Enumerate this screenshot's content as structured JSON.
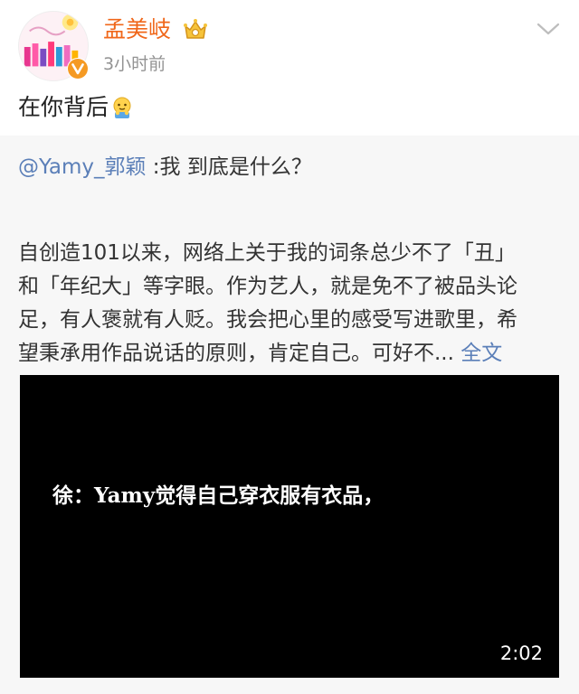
{
  "post": {
    "author_name": "孟美岐",
    "time": "3小时前",
    "text": "在你背后",
    "emoji_icon": "shy-face-emoji",
    "avatar_icon": "avatar-image",
    "badge_icon": "verified-v-icon",
    "crown_icon": "vip-crown-icon",
    "menu_icon": "chevron-down-icon"
  },
  "repost": {
    "mention": "@Yamy_郭颖",
    "quote": " :我 到底是什么？",
    "body_lines": [
      "自创造101以来，网络上关于我的词条总少不了「丑」",
      "和「年纪大」等字眼。作为艺人，就是免不了被品头论",
      "足，有人褒就有人贬。我会把心里的感受写进歌里，希",
      "望秉承用作品说话的原则，肯定自己。可好不..."
    ],
    "full_text_label": "全文"
  },
  "video": {
    "subtitle": "徐：Yamy觉得自己穿衣服有衣品，",
    "duration": "2:02"
  },
  "colors": {
    "author_name": "#f0671a",
    "link": "#5b7fb8",
    "repost_background": "#f7f7f7",
    "time": "#939393"
  }
}
